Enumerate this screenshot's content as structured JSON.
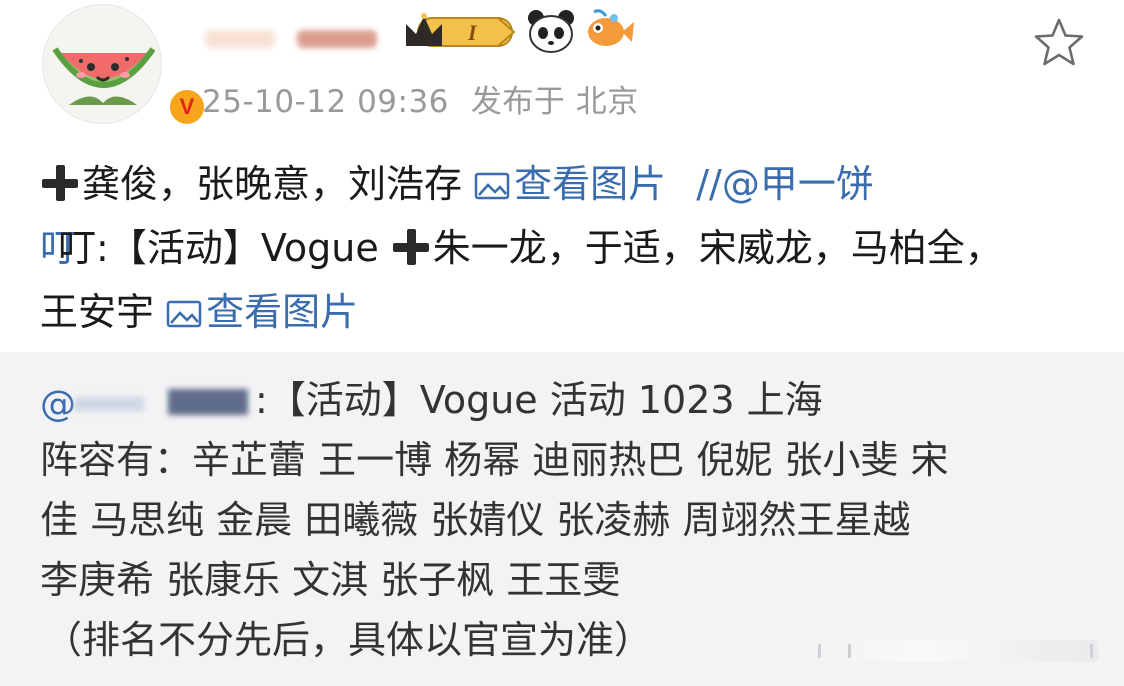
{
  "header": {
    "timestamp": "25-10-12 09:36",
    "location": "发布于 北京",
    "level_badge": "I",
    "verified_badge": "V"
  },
  "post": {
    "line1_text": "龚俊，张晚意，刘浩存",
    "view_image_label": "查看图片",
    "mention": "//@甲一饼",
    "line2_prefix": "叮:【活动】Vogue",
    "line2_names": "朱一龙，于适，宋威龙，马柏全，",
    "line3_names": "王安宇",
    "view_image_label_2": "查看图片"
  },
  "repost": {
    "title_suffix": ":【活动】Vogue 活动 1023 上海",
    "lineup_line1": "阵容有：辛芷蕾 王一博 杨幂 迪丽热巴 倪妮 张小斐 宋",
    "lineup_line2": "佳 马思纯 金晨 田曦薇 张婧仪 张凌赫 周翊然王星越",
    "lineup_line3": "李庚希 张康乐 文淇 张子枫 王玉雯",
    "note": "（排名不分先后，具体以官宣为准）"
  },
  "colors": {
    "link": "#3a6dae",
    "meta_text": "#999999",
    "repost_bg": "#f3f3f5",
    "badge_orange": "#f7a51b"
  }
}
